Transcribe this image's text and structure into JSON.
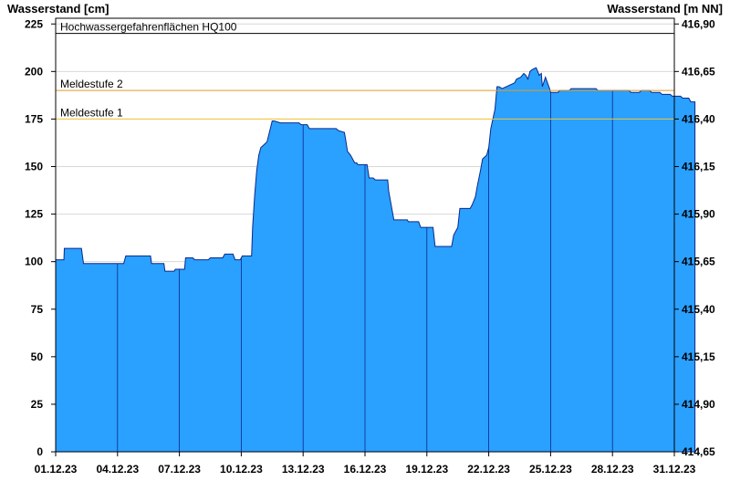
{
  "chart_data": {
    "type": "area",
    "ylabel_left": "Wasserstand [cm]",
    "ylabel_right": "Wasserstand [m NN]",
    "ylim": [
      0,
      228
    ],
    "y_ticks": [
      0,
      25,
      50,
      75,
      100,
      125,
      150,
      175,
      200,
      225
    ],
    "y_right_ticks": [
      "414,65",
      "414,90",
      "415,15",
      "415,40",
      "415,65",
      "415,90",
      "416,15",
      "416,40",
      "416,65",
      "416,90"
    ],
    "x_range": [
      "01.12.23",
      "31.12.23"
    ],
    "x_ticks": [
      "01.12.23",
      "04.12.23",
      "07.12.23",
      "10.12.23",
      "13.12.23",
      "16.12.23",
      "19.12.23",
      "22.12.23",
      "25.12.23",
      "28.12.23",
      "31.12.23"
    ],
    "colors": {
      "fill": "#2aa0ff",
      "line": "#0a2a8a",
      "hq100": "#000000",
      "meldestufe2": "#e09a2e",
      "meldestufe1": "#f2c637"
    },
    "reference_lines": [
      {
        "name": "Hochwassergefahrenflächen HQ100",
        "value": 220
      },
      {
        "name": "Meldestufe 2",
        "value": 190
      },
      {
        "name": "Meldestufe 1",
        "value": 175
      }
    ],
    "series": [
      {
        "x": [
          0.0,
          0.4,
          0.42,
          1.25,
          1.35,
          3.3,
          3.4,
          4.6,
          4.65,
          5.25,
          5.3,
          5.75,
          5.8,
          6.25,
          6.3,
          6.65,
          6.75,
          7.4,
          7.5,
          8.1,
          8.2,
          8.6,
          8.7,
          8.95,
          9.05,
          9.5,
          9.55,
          9.65,
          9.75,
          9.85,
          9.95,
          10.05,
          10.15,
          10.25,
          10.5,
          10.6,
          10.9,
          11.05,
          11.1,
          11.2,
          11.8,
          11.9,
          12.2,
          12.3,
          13.6,
          13.7,
          14.0,
          14.05,
          14.15,
          14.3,
          14.5,
          14.6,
          14.65,
          15.1,
          15.2,
          15.4,
          15.5,
          16.1,
          16.15,
          16.3,
          16.4,
          16.5,
          17.05,
          17.1,
          17.6,
          17.7,
          18.2,
          18.3,
          18.4,
          19.2,
          19.3,
          19.5,
          19.6,
          20.1,
          20.2,
          20.35,
          20.45,
          20.6,
          20.7,
          20.8,
          20.9,
          21.0,
          21.1,
          21.3,
          21.4,
          21.5,
          21.65,
          22.25,
          22.35,
          22.55,
          22.7,
          22.8,
          22.9,
          23.0,
          23.1,
          23.3,
          23.45,
          23.55,
          23.6,
          23.75,
          23.85,
          23.95,
          24.0,
          24.35,
          24.45,
          24.9,
          25.0,
          26.2,
          26.3,
          27.1,
          27.2,
          27.8,
          27.9,
          28.3,
          28.4,
          28.8,
          28.9,
          29.3,
          29.4,
          29.8,
          29.9,
          30.3,
          30.4,
          30.7,
          30.8,
          31.0
        ],
        "values": [
          101,
          101,
          107,
          107,
          99,
          99,
          103,
          103,
          99,
          99,
          95,
          95,
          96,
          96,
          102,
          102,
          101,
          101,
          102,
          102,
          104,
          104,
          101,
          101,
          103,
          103,
          118,
          135,
          148,
          156,
          160,
          161,
          162,
          163,
          174,
          174,
          173,
          173,
          173,
          173,
          173,
          172,
          172,
          170,
          170,
          169,
          168,
          165,
          158,
          156,
          152,
          152,
          151,
          151,
          144,
          144,
          143,
          143,
          137,
          128,
          122,
          122,
          122,
          121,
          121,
          118,
          118,
          118,
          108,
          108,
          114,
          118,
          128,
          128,
          130,
          134,
          140,
          148,
          154,
          155,
          156,
          160,
          170,
          180,
          192,
          192,
          191,
          194,
          196,
          197,
          199,
          198,
          196,
          200,
          201,
          202,
          198,
          199,
          192,
          197,
          194,
          191,
          189,
          189,
          190,
          190,
          191,
          191,
          190,
          190,
          190,
          190,
          189,
          189,
          190,
          190,
          189,
          189,
          188,
          188,
          187,
          187,
          186,
          186,
          184,
          184
        ]
      }
    ]
  }
}
